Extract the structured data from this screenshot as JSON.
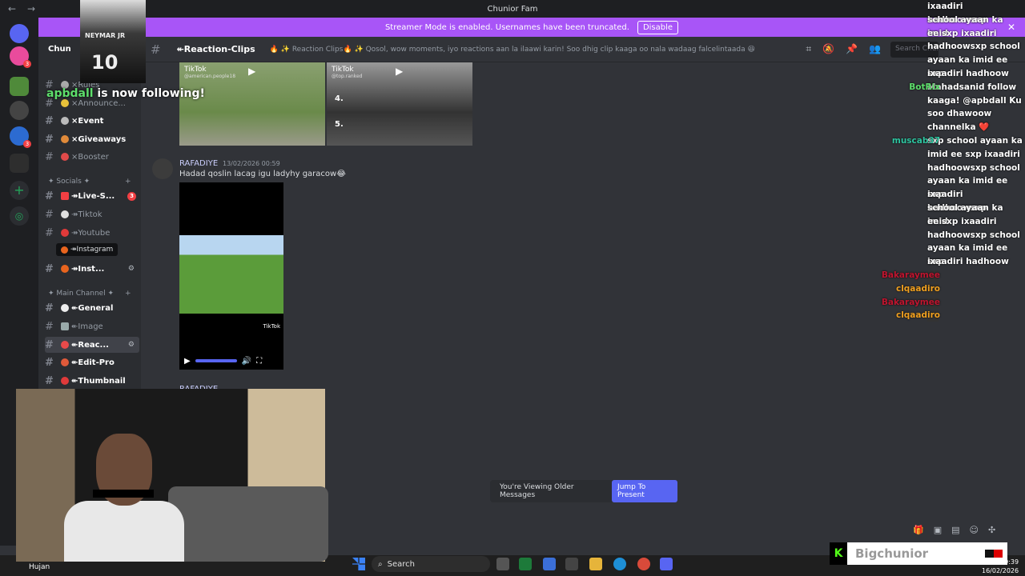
{
  "window": {
    "title": "Chunior Fam",
    "back_icon": "←",
    "forward_icon": "→"
  },
  "banner": {
    "text": "Streamer Mode is enabled. Usernames have been truncated.",
    "button": "Disable",
    "close": "✕"
  },
  "server_rail": {
    "badges": [
      "3",
      "3"
    ]
  },
  "channels": {
    "server_name": "Chun",
    "top_items": [
      {
        "label": "×Rules"
      },
      {
        "label": "×Announce..."
      },
      {
        "label": "×Event"
      },
      {
        "label": "×Giveaways"
      },
      {
        "label": "×Booster"
      }
    ],
    "socials_category": "✦ Socials ✦",
    "socials": [
      {
        "label": "↠Live-S...",
        "badge": "3",
        "color": "#f23f43"
      },
      {
        "label": "↠Tiktok",
        "color": "#e0e0e0"
      },
      {
        "label": "↠Youtube",
        "color": "#e03a3a"
      },
      {
        "label": "↠Inst...",
        "color": "#e8641e"
      }
    ],
    "tooltip": "↠Instagram",
    "main_category": "✦ Main Channel ✦",
    "main": [
      {
        "label": "↞General"
      },
      {
        "label": "↞Image"
      },
      {
        "label": "↞Reac..."
      },
      {
        "label": "↞Edit-Pro"
      },
      {
        "label": "↞Thumbnail"
      }
    ]
  },
  "header": {
    "channel": "↞Reaction-Clips",
    "topic": "🔥 ✨ Reaction Clips🔥 ✨ Qosol, wow moments, iyo reactions aan la ilaawi karin! Soo dhig clip kaaga oo nala wadaag falcelintaada 😆",
    "search_placeholder": "Search Chunior Fam"
  },
  "messages": {
    "clip1": {
      "label": "TikTok",
      "sub": "@american.people18"
    },
    "clip2": {
      "label": "TikTok",
      "sub": "@top.ranked"
    },
    "clip2_numbers": [
      "4.",
      "5."
    ],
    "post": {
      "author": "RAFADIYE",
      "timestamp": "13/02/2026 00:59",
      "text": "Hadad qoslin lacag igu ladyhy  garacow😂"
    },
    "video_watermark": "TikTok",
    "next_author": "RAFADIYE"
  },
  "older_notice": {
    "text": "You're Viewing Older Messages",
    "button": "Jump To Present"
  },
  "overlay": {
    "follow_user": "apbdall",
    "follow_text": " is now following!",
    "jersey_name": "NEYMAR JR",
    "jersey_number": "10",
    "chat": [
      {
        "user": "",
        "text": "ixaadiri hadhoowsxp"
      },
      {
        "user": "",
        "text": "school ayaan ka imid"
      },
      {
        "user": "",
        "text": "ee sxp ixaadiri"
      },
      {
        "user": "",
        "text": "hadhoowsxp school"
      },
      {
        "user": "",
        "text": "ayaan ka imid ee sxp"
      },
      {
        "user": "",
        "text": "ixaadiri hadhoow"
      },
      {
        "user": "BotRix",
        "user_color": "#5dde6b",
        "text": "Mahadsanid follow"
      },
      {
        "user": "",
        "text": "kaaga! @apbdall Ku"
      },
      {
        "user": "",
        "text": "soo dhawoow"
      },
      {
        "user": "",
        "text": "channelka ❤️"
      },
      {
        "user": "muscab37",
        "user_color": "#2ec4a0",
        "text": "sxp school ayaan ka"
      },
      {
        "user": "",
        "text": "imid ee sxp ixaadiri"
      },
      {
        "user": "",
        "text": "hadhoowsxp school"
      },
      {
        "user": "",
        "text": "ayaan ka imid ee sxp"
      },
      {
        "user": "",
        "text": "ixaadiri hadhoowsxp"
      },
      {
        "user": "",
        "text": "school ayaan ka imid"
      },
      {
        "user": "",
        "text": "ee sxp ixaadiri"
      },
      {
        "user": "",
        "text": "hadhoowsxp school"
      },
      {
        "user": "",
        "text": "ayaan ka imid ee sxp"
      },
      {
        "user": "",
        "text": "ixaadiri hadhoow"
      },
      {
        "user": "Bakaraymee",
        "user_color": "#c0152f",
        "text": ""
      },
      {
        "user": "clqaadiro",
        "user_color": "#f0a020",
        "text": ""
      },
      {
        "user": "Bakaraymee",
        "user_color": "#c0152f",
        "text": ""
      },
      {
        "user": "clqaadiro",
        "user_color": "#f0a020",
        "text": ""
      }
    ],
    "brand_name": "Bigchunior",
    "brand_logo": "K"
  },
  "taskbar": {
    "weather": "Hujan",
    "search": "Search",
    "time": "09:39",
    "date": "16/02/2026"
  }
}
